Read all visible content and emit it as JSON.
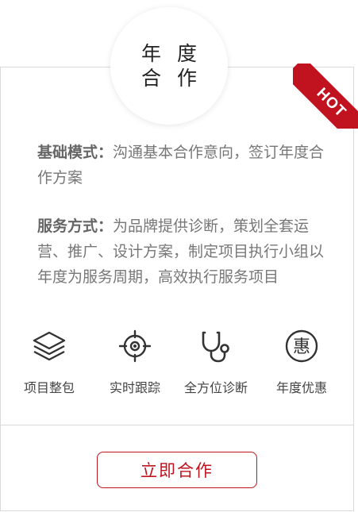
{
  "card": {
    "title_line1": "年 度",
    "title_line2": "合 作",
    "badge": "HOT"
  },
  "basic": {
    "label": "基础模式：",
    "text": "沟通基本合作意向，签订年度合作方案"
  },
  "service": {
    "label": "服务方式：",
    "text": "为品牌提供诊断，策划全套运营、推广、设计方案，制定项目执行小组以年度为服务周期，高效执行服务项目"
  },
  "features": [
    {
      "icon": "layers-icon",
      "label": "项目整包"
    },
    {
      "icon": "target-icon",
      "label": "实时跟踪"
    },
    {
      "icon": "stethoscope-icon",
      "label": "全方位诊断"
    },
    {
      "icon": "hui-discount-icon",
      "label": "年度优惠",
      "glyph": "惠"
    }
  ],
  "cta": {
    "label": "立即合作"
  },
  "colors": {
    "accent": "#c1121f",
    "border": "#d9d9d9",
    "text": "#777777"
  }
}
